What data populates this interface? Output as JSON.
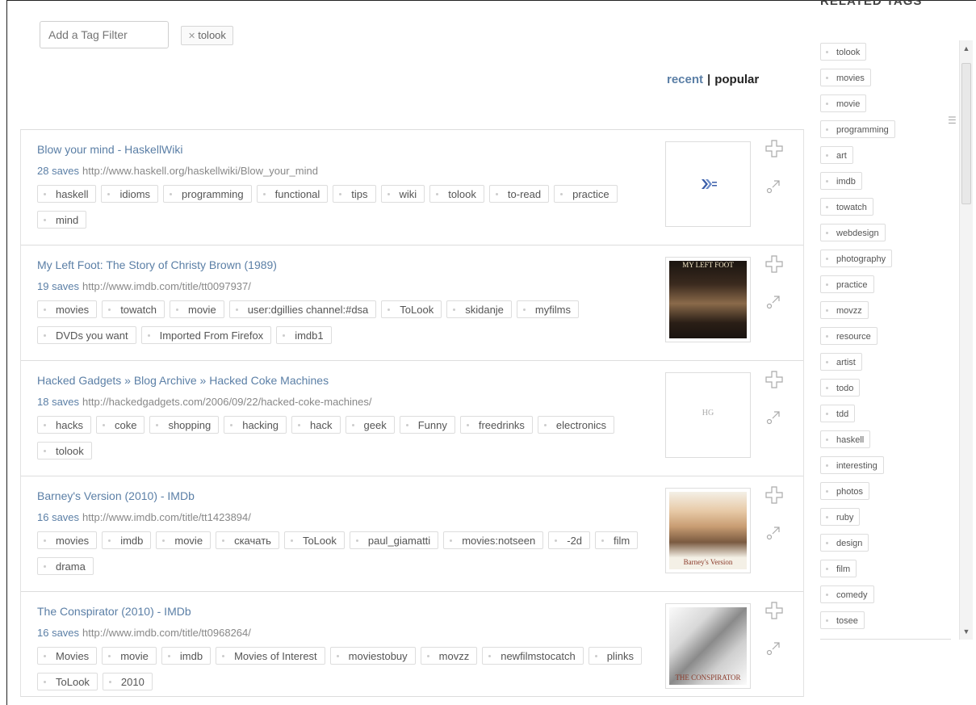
{
  "filter": {
    "placeholder": "Add a Tag Filter",
    "active_tag": "tolook"
  },
  "sort": {
    "recent": "recent",
    "separator": "|",
    "popular": "popular"
  },
  "bookmarks": [
    {
      "title": "Blow your mind - HaskellWiki",
      "saves": "28 saves",
      "url": "http://www.haskell.org/haskellwiki/Blow_your_mind",
      "tags": [
        "haskell",
        "idioms",
        "programming",
        "functional",
        "tips",
        "wiki",
        "tolook",
        "to-read",
        "practice",
        "mind"
      ],
      "thumb": "haskell-logo"
    },
    {
      "title": "My Left Foot: The Story of Christy Brown (1989)",
      "saves": "19 saves",
      "url": "http://www.imdb.com/title/tt0097937/",
      "tags": [
        "movies",
        "towatch",
        "movie",
        "user:dgillies channel:#dsa",
        "ToLook",
        "skidanje",
        "myfilms",
        "DVDs you want",
        "Imported From Firefox",
        "imdb1"
      ],
      "thumb": "poster",
      "poster_text": "MY LEFT FOOT"
    },
    {
      "title": "Hacked Gadgets » Blog Archive » Hacked Coke Machines",
      "saves": "18 saves",
      "url": "http://hackedgadgets.com/2006/09/22/hacked-coke-machines/",
      "tags": [
        "hacks",
        "coke",
        "shopping",
        "hacking",
        "hack",
        "geek",
        "Funny",
        "freedrinks",
        "electronics",
        "tolook"
      ],
      "thumb": "hg-logo",
      "logo_text": "HG"
    },
    {
      "title": "Barney's Version (2010) - IMDb",
      "saves": "16 saves",
      "url": "http://www.imdb.com/title/tt1423894/",
      "tags": [
        "movies",
        "imdb",
        "movie",
        "скачать",
        "ToLook",
        "paul_giamatti",
        "movies:notseen",
        "-2d",
        "film",
        "drama"
      ],
      "thumb": "poster",
      "poster_text": "Barney's Version"
    },
    {
      "title": "The Conspirator (2010) - IMDb",
      "saves": "16 saves",
      "url": "http://www.imdb.com/title/tt0968264/",
      "tags": [
        "Movies",
        "movie",
        "imdb",
        "Movies of Interest",
        "moviestobuy",
        "movzz",
        "newfilmstocatch",
        "plinks",
        "ToLook",
        "2010"
      ],
      "thumb": "poster",
      "poster_text": "THE CONSPIRATOR"
    }
  ],
  "related": {
    "title": "RELATED TAGS",
    "tags": [
      "tolook",
      "movies",
      "movie",
      "programming",
      "art",
      "imdb",
      "towatch",
      "webdesign",
      "photography",
      "practice",
      "movzz",
      "resource",
      "artist",
      "todo",
      "tdd",
      "haskell",
      "interesting",
      "photos",
      "ruby",
      "design",
      "film",
      "comedy",
      "tosee"
    ]
  },
  "icons": {
    "add": "add-icon",
    "share": "share-icon",
    "remove": "remove-tag-icon"
  },
  "colors": {
    "link": "#5b7fa6",
    "border": "#dddddd"
  }
}
